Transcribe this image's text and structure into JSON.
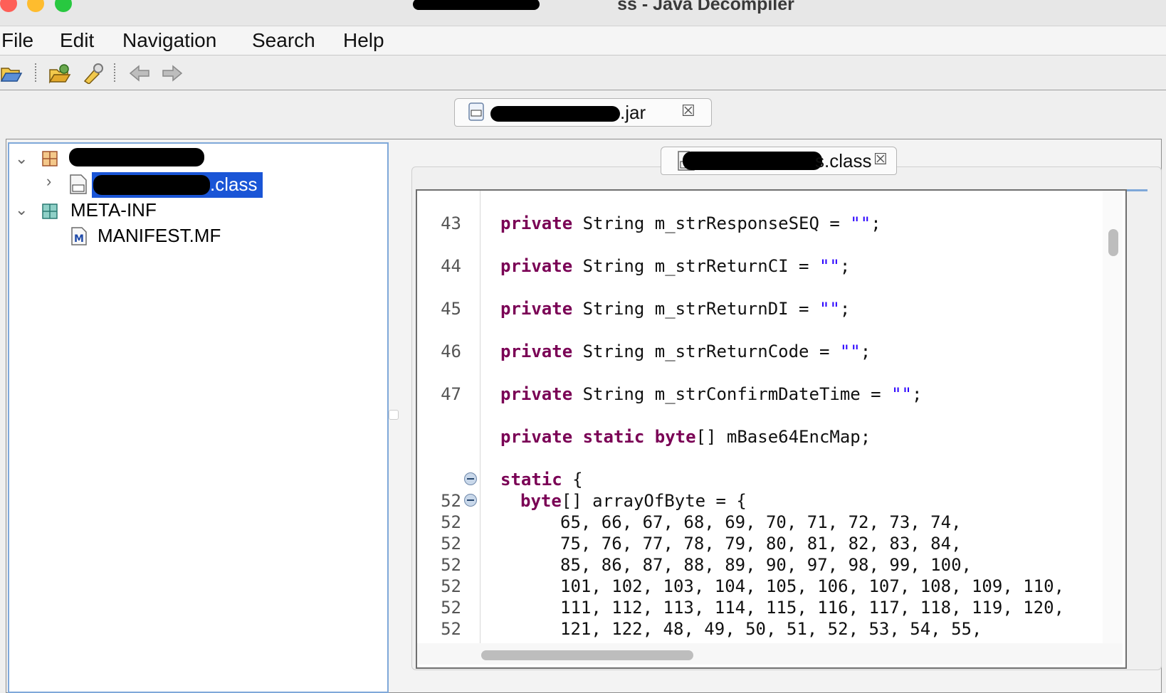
{
  "window": {
    "title": "ss - Java Decompiler",
    "traffic_lights": [
      {
        "name": "close",
        "color": "#fe5f57"
      },
      {
        "name": "minimize",
        "color": "#febc2e"
      },
      {
        "name": "zoom",
        "color": "#28c840"
      }
    ]
  },
  "menubar": {
    "items": [
      "File",
      "Edit",
      "Navigation",
      "Search",
      "Help"
    ]
  },
  "toolbar": {
    "icons": [
      "open-file-icon",
      "open-type-icon",
      "search-icon",
      "back-icon",
      "forward-icon"
    ]
  },
  "tabs": {
    "jar_tab": {
      "label": ".jar",
      "close": "☒"
    },
    "class_tab": {
      "label": "s.class",
      "close": "☒"
    }
  },
  "tree": {
    "items": [
      {
        "label": "",
        "type": "package",
        "expanded": true
      },
      {
        "label": ".class",
        "type": "class",
        "selected": true
      },
      {
        "label": "META-INF",
        "type": "folder",
        "expanded": true
      },
      {
        "label": "MANIFEST.MF",
        "type": "manifest"
      }
    ]
  },
  "editor": {
    "line_numbers": [
      "43",
      "44",
      "45",
      "46",
      "47",
      "",
      "",
      "52",
      "52",
      "52",
      "52",
      "52",
      "52",
      "52"
    ],
    "lines": [
      {
        "kw": "private",
        "rest": " String m_strResponseSEQ = ",
        "str": "\"\"",
        "tail": ";"
      },
      {
        "kw": "private",
        "rest": " String m_strReturnCI = ",
        "str": "\"\"",
        "tail": ";"
      },
      {
        "kw": "private",
        "rest": " String m_strReturnDI = ",
        "str": "\"\"",
        "tail": ";"
      },
      {
        "kw": "private",
        "rest": " String m_strReturnCode = ",
        "str": "\"\"",
        "tail": ";"
      },
      {
        "kw": "private",
        "rest": " String m_strConfirmDateTime = ",
        "str": "\"\"",
        "tail": ";"
      },
      {
        "kw": "private static byte",
        "rest": "[] mBase64EncMap;",
        "str": "",
        "tail": ""
      },
      {
        "kw": "static",
        "rest": " {",
        "str": "",
        "tail": ""
      },
      {
        "kw": "byte",
        "rest": "[] arrayOfByte = {",
        "str": "",
        "tail": ""
      },
      {
        "kw": "",
        "rest": "65, 66, 67, 68, 69, 70, 71, 72, 73, 74,",
        "str": "",
        "tail": ""
      },
      {
        "kw": "",
        "rest": "75, 76, 77, 78, 79, 80, 81, 82, 83, 84,",
        "str": "",
        "tail": ""
      },
      {
        "kw": "",
        "rest": "85, 86, 87, 88, 89, 90, 97, 98, 99, 100,",
        "str": "",
        "tail": ""
      },
      {
        "kw": "",
        "rest": "101, 102, 103, 104, 105, 106, 107, 108, 109, 110,",
        "str": "",
        "tail": ""
      },
      {
        "kw": "",
        "rest": "111, 112, 113, 114, 115, 116, 117, 118, 119, 120,",
        "str": "",
        "tail": ""
      },
      {
        "kw": "",
        "rest": "121, 122, 48, 49, 50, 51, 52, 53, 54, 55,",
        "str": "",
        "tail": ""
      }
    ]
  },
  "colors": {
    "keyword": "#7a0055",
    "string": "#2a00ff",
    "selection": "#1a55d6",
    "tree_border": "#7fa8d9"
  }
}
